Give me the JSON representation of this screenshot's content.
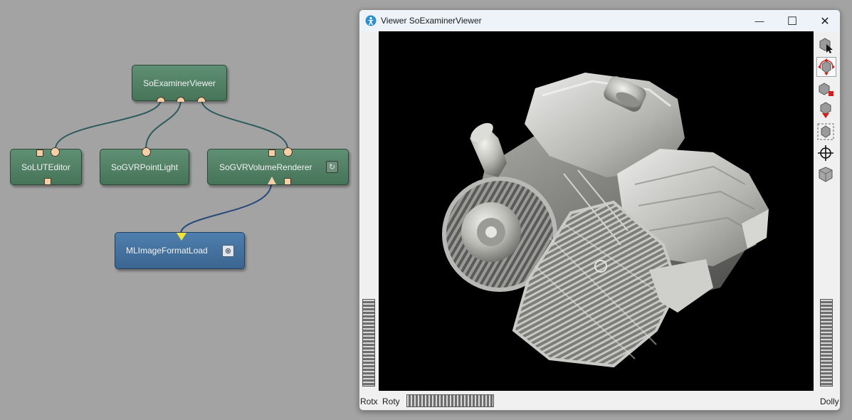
{
  "network": {
    "modules": {
      "examiner_viewer": "SoExaminerViewer",
      "lut_editor": "SoLUTEditor",
      "point_light": "SoGVRPointLight",
      "volume_renderer": "SoGVRVolumeRenderer",
      "image_load": "MLImageFormatLoad"
    },
    "colors": {
      "canvas": "#a3a3a3",
      "inventor_module": "#52806a",
      "ml_module": "#4373a2",
      "connection": "#2c5a5c",
      "image_connection": "#26497a",
      "port": "#f5cfa8",
      "output_trigger": "#f2e23a"
    }
  },
  "viewer": {
    "title": "Viewer SoExaminerViewer",
    "window_controls": {
      "minimize": "—",
      "maximize": "☐",
      "close": "✕"
    },
    "toolbar_icons": [
      "pick-mode-icon",
      "view-mode-icon",
      "home-icon",
      "set-home-icon",
      "view-all-icon",
      "seek-icon",
      "projection-icon"
    ],
    "wheels": {
      "rotx": "Rotx",
      "roty": "Roty",
      "dolly": "Dolly"
    },
    "viewport_background": "#000000"
  }
}
